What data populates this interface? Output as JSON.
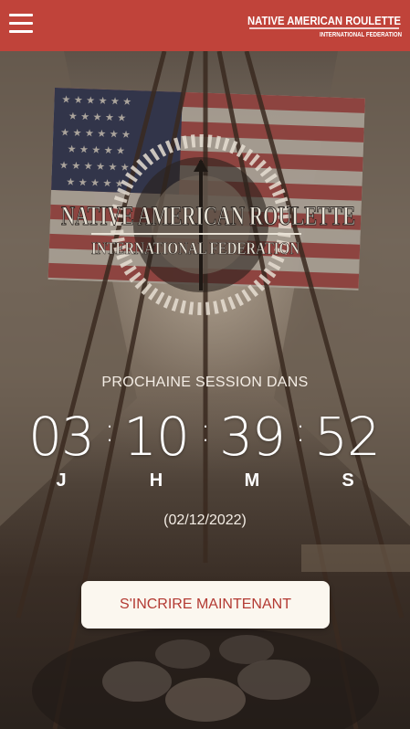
{
  "header": {
    "menu_icon": "hamburger-menu-icon",
    "logo": {
      "line1": "NATIVE AMERICAN ROULETTE",
      "line2": "INTERNATIONAL FEDERATION"
    }
  },
  "hero": {
    "logo": {
      "line1": "NATIVE AMERICAN ROULETTE",
      "line2": "INTERNATIONAL FEDERATION"
    }
  },
  "countdown": {
    "label": "PROCHAINE SESSION DANS",
    "days": "03",
    "hours": "10",
    "minutes": "39",
    "seconds": "52",
    "separator": ":",
    "units": {
      "days": "J",
      "hours": "H",
      "minutes": "M",
      "seconds": "S"
    },
    "date": "(02/12/2022)"
  },
  "cta": {
    "label": "S'INCRIRE MAINTENANT"
  },
  "colors": {
    "header_bg": "#c0433a",
    "cta_bg": "#fbf7ef",
    "cta_text": "#b33a33",
    "flag_red": "#b53a3a",
    "flag_blue": "#2e3a5e"
  }
}
